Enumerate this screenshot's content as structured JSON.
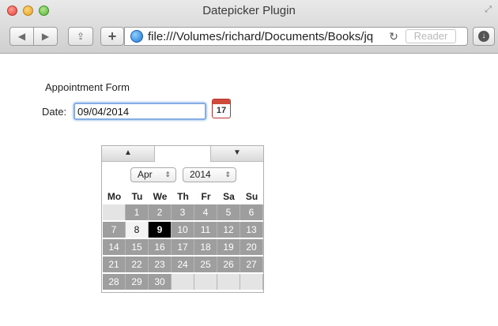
{
  "window": {
    "title": "Datepicker Plugin",
    "url": "file:///Volumes/richard/Documents/Books/jq",
    "reader_label": "Reader"
  },
  "form": {
    "title": "Appointment Form",
    "date_label": "Date:",
    "date_value": "09/04/2014",
    "calendar_icon_day": "17"
  },
  "datepicker": {
    "prev_glyph": "▲",
    "next_glyph": "▼",
    "month": "Apr",
    "year": "2014",
    "weekdays": [
      "Mo",
      "Tu",
      "We",
      "Th",
      "Fr",
      "Sa",
      "Su"
    ],
    "weeks": [
      [
        "",
        "1",
        "2",
        "3",
        "4",
        "5",
        "6"
      ],
      [
        "7",
        "8",
        "9",
        "10",
        "11",
        "12",
        "13"
      ],
      [
        "14",
        "15",
        "16",
        "17",
        "18",
        "19",
        "20"
      ],
      [
        "21",
        "22",
        "23",
        "24",
        "25",
        "26",
        "27"
      ],
      [
        "28",
        "29",
        "30",
        "",
        "",
        "",
        ""
      ]
    ],
    "today": "8",
    "selected": "9"
  },
  "icons": {
    "close": "close-icon",
    "minimize": "minimize-icon",
    "maximize": "maximize-icon",
    "back": "back-arrow-icon",
    "forward": "forward-arrow-icon",
    "share": "share-icon",
    "add_bookmark": "plus-icon",
    "globe": "globe-icon",
    "reload": "reload-icon",
    "download": "download-icon",
    "calendar": "calendar-icon"
  }
}
